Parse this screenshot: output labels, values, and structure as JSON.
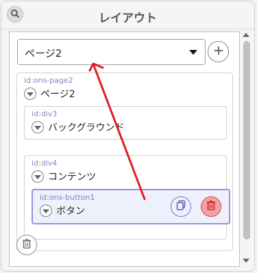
{
  "header": {
    "title": "レイアウト"
  },
  "select": {
    "value": "ページ2"
  },
  "tree": {
    "page": {
      "id": "id:ons-page2",
      "label": "ページ2"
    },
    "background": {
      "id": "id:div3",
      "label": "バックグラウンド"
    },
    "contents": {
      "id": "id:div4",
      "label": "コンテンツ"
    },
    "button": {
      "id": "id:ons-button1",
      "label": "ボタン"
    }
  },
  "colors": {
    "selected_border": "#8f93e6",
    "delete_red": "#d14d4d",
    "annotation_red": "#e01b24"
  },
  "icons": [
    "search-icon",
    "caret-down-icon",
    "plus-icon",
    "chevron-down-icon",
    "copy-icon",
    "trash-icon",
    "arrow-annotation"
  ]
}
